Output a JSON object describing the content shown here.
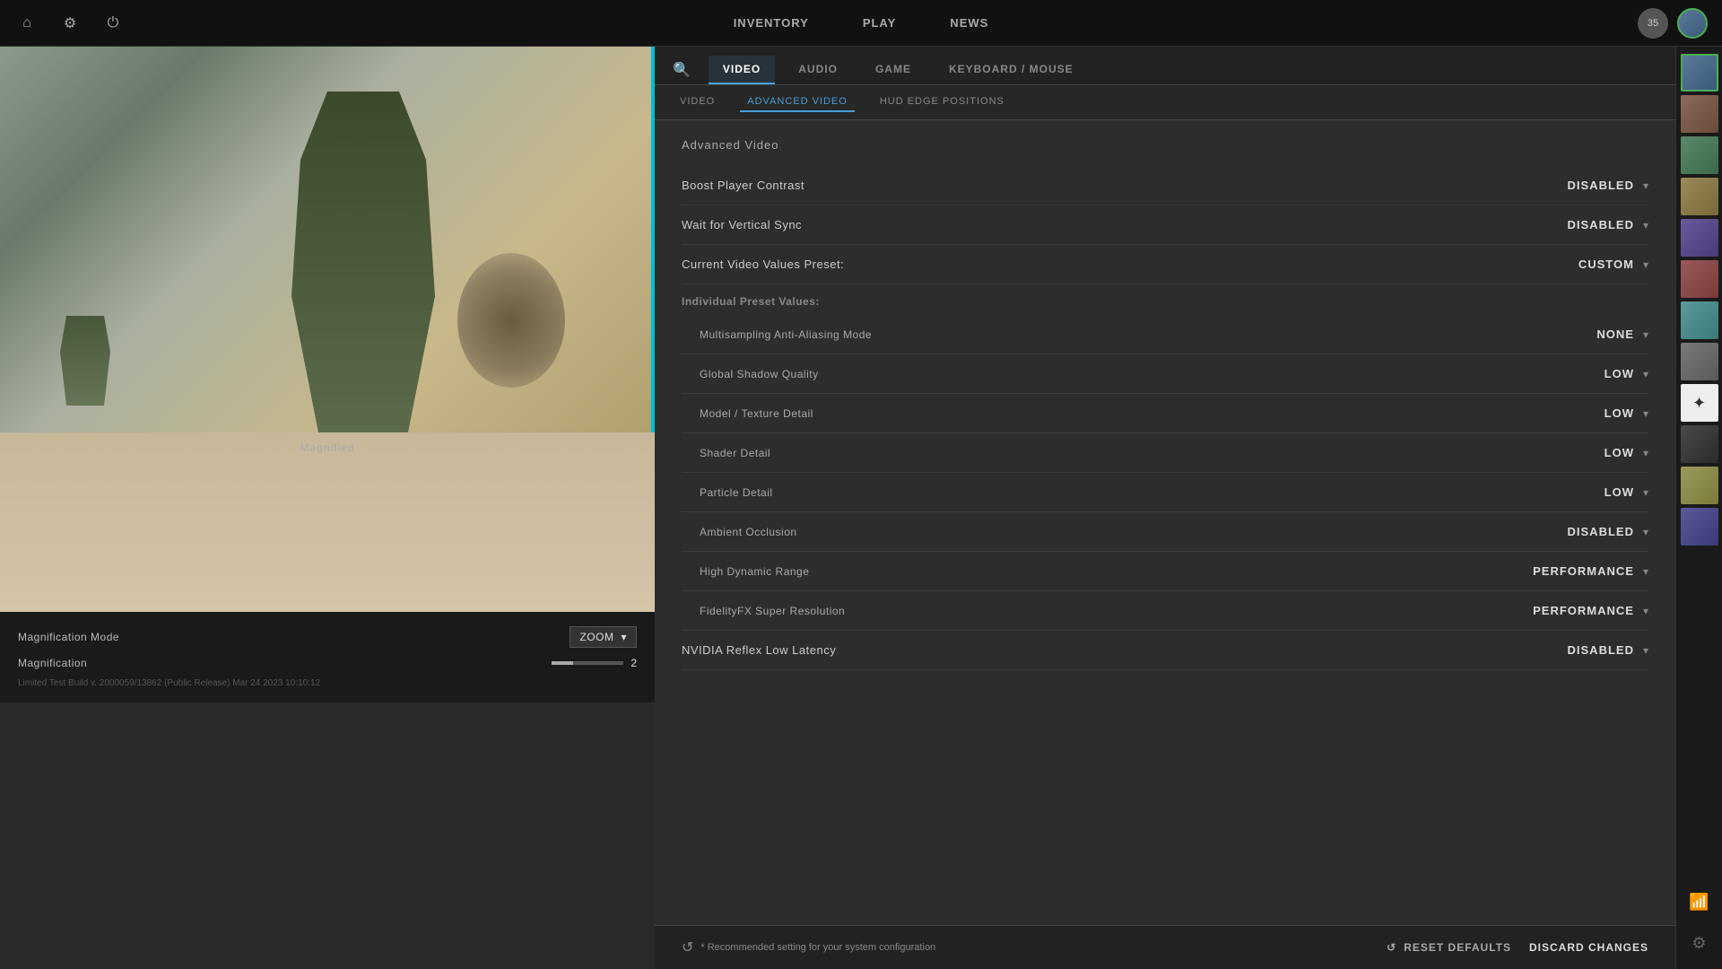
{
  "topbar": {
    "nav_items": [
      "INVENTORY",
      "PLAY",
      "NEWS"
    ],
    "user_level": "35"
  },
  "tabs": {
    "main": [
      "VIDEO",
      "AUDIO",
      "GAME",
      "KEYBOARD / MOUSE"
    ],
    "active_main": "VIDEO",
    "sub": [
      "VIDEO",
      "ADVANCED VIDEO",
      "HUD EDGE POSITIONS"
    ],
    "active_sub": "ADVANCED VIDEO"
  },
  "section": {
    "title": "Advanced Video"
  },
  "settings": [
    {
      "name": "Boost Player Contrast",
      "value": "DISABLED",
      "indented": false
    },
    {
      "name": "Wait for Vertical Sync",
      "value": "DISABLED",
      "indented": false
    },
    {
      "name": "Current Video Values Preset:",
      "value": "CUSTOM",
      "indented": false,
      "type": "preset"
    },
    {
      "name": "Individual Preset Values:",
      "type": "section-label"
    },
    {
      "name": "Multisampling Anti-Aliasing Mode",
      "value": "NONE",
      "indented": true
    },
    {
      "name": "Global Shadow Quality",
      "value": "LOW",
      "indented": true
    },
    {
      "name": "Model / Texture Detail",
      "value": "LOW",
      "indented": true
    },
    {
      "name": "Shader Detail",
      "value": "LOW",
      "indented": true
    },
    {
      "name": "Particle Detail",
      "value": "LOW",
      "indented": true
    },
    {
      "name": "Ambient Occlusion",
      "value": "DISABLED",
      "indented": true
    },
    {
      "name": "High Dynamic Range",
      "value": "PERFORMANCE",
      "indented": true
    },
    {
      "name": "FidelityFX Super Resolution",
      "value": "PERFORMANCE",
      "indented": true
    },
    {
      "name": "NVIDIA Reflex Low Latency",
      "value": "DISABLED",
      "indented": false
    }
  ],
  "bottom_bar": {
    "recommend_text": "* Recommended setting for your system configuration",
    "reset_label": "RESET DEFAULTS",
    "discard_label": "DISCARD CHANGES"
  },
  "left_panel": {
    "magnified_label": "Magnified",
    "magnification_mode_label": "Magnification Mode",
    "magnification_mode_value": "ZOOM",
    "magnification_label": "Magnification",
    "magnification_value": "2",
    "version_text": "Limited Test Build v. 2000059/13862 (Public Release) Mar 24 2023 10:10:12"
  }
}
